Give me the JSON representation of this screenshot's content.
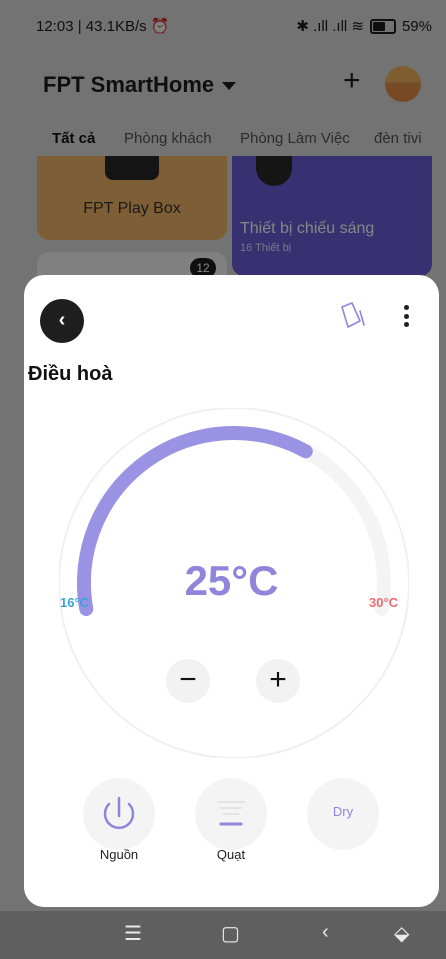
{
  "status_bar": {
    "left_text": "12:03 | 43.1KB/s ⏰",
    "right_icons": "✱ .ıll .ıll ≋",
    "battery": "59%"
  },
  "header": {
    "home_name": "FPT SmartHome",
    "add_symbol": "+"
  },
  "tabs": [
    "Tất cả",
    "Phòng khách",
    "Phòng Làm Việc",
    "đèn tivi"
  ],
  "cards": {
    "card1_label": "FPT Play Box",
    "card2_title": "Thiết bị chiếu sáng",
    "card2_sub": "16 Thiết bị",
    "badge": "12"
  },
  "sheet": {
    "back_glyph": "‹",
    "title": "Điều hoà",
    "temperature": "25°C",
    "min_label": "16°C",
    "max_label": "30°C",
    "temperature_value": 25,
    "temperature_min": 16,
    "temperature_max": 30,
    "minus_glyph": "−",
    "plus_glyph": "+",
    "controls": {
      "power_label": "Nguồn",
      "fan_label": "Quạt",
      "dry_label": "Dry"
    }
  },
  "colors": {
    "accent": "#8f86dc",
    "min_color": "#3aa3da",
    "max_color": "#ea6b73"
  },
  "navbar": {
    "menu_glyph": "☰",
    "home_glyph": "▢",
    "back_glyph": "‹",
    "extra_glyph": "⬙"
  }
}
